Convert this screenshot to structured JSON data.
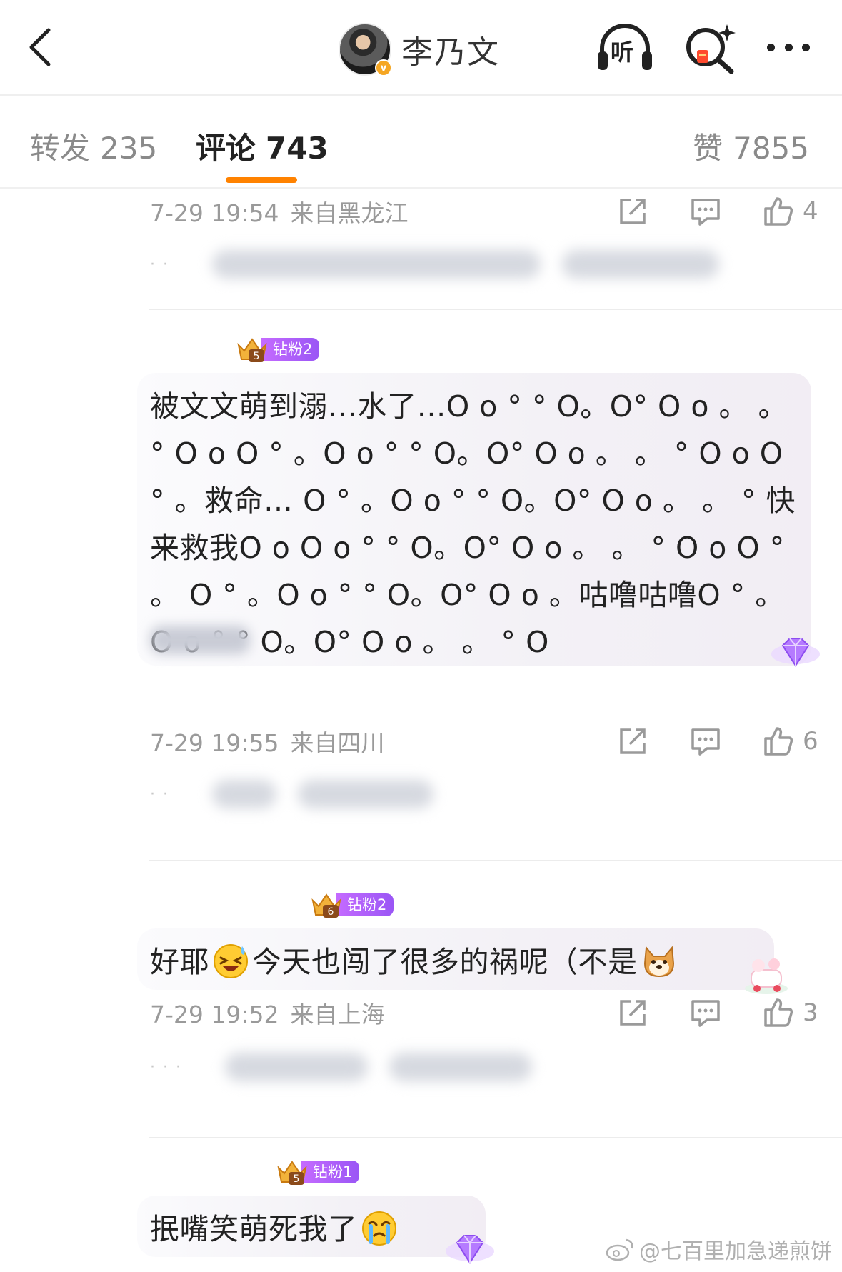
{
  "header": {
    "username": "李乃文",
    "verified_mark": "v",
    "listen_label": "听"
  },
  "tabs": {
    "repost": {
      "label": "转发",
      "count": "235"
    },
    "comments": {
      "label": "评论",
      "count": "743"
    },
    "likes": {
      "label": "赞",
      "count": "7855"
    }
  },
  "comments": [
    {
      "time": "7-29 19:54",
      "location": "来自黑龙江",
      "likes": "4"
    },
    {
      "fan_badge": "钻粉2",
      "fan_level": "5",
      "text": "被文文萌到溺…水了…O o ° ° O。O° O o 。 。 ° O o O ° 。O o ° ° O。O° O o 。 。 ° O o O ° 。救命… O ° 。O o ° ° O。O° O o 。 。 ° 快来救我O o O o ° ° O。O° O o 。 。 ° O o O ° 。 O ° 。O o ° ° O。O° O o 。咕噜咕噜O ° 。O o ° ° O。O° O o 。 。 ° O",
      "time": "7-29 19:55",
      "location": "来自四川",
      "likes": "6"
    },
    {
      "fan_badge": "钻粉2",
      "fan_level": "6",
      "text_before": "好耶",
      "text_after": "今天也闯了很多的祸呢（不是",
      "time": "7-29 19:52",
      "location": "来自上海",
      "likes": "3"
    },
    {
      "fan_badge": "钻粉1",
      "fan_level": "5",
      "text": "抿嘴笑萌死我了"
    }
  ],
  "watermark": "@七百里加急递煎饼",
  "colors": {
    "accent_orange": "#ff8200",
    "fan_badge_purple": "#a95cf7",
    "meta_gray": "#9a9a9a"
  }
}
